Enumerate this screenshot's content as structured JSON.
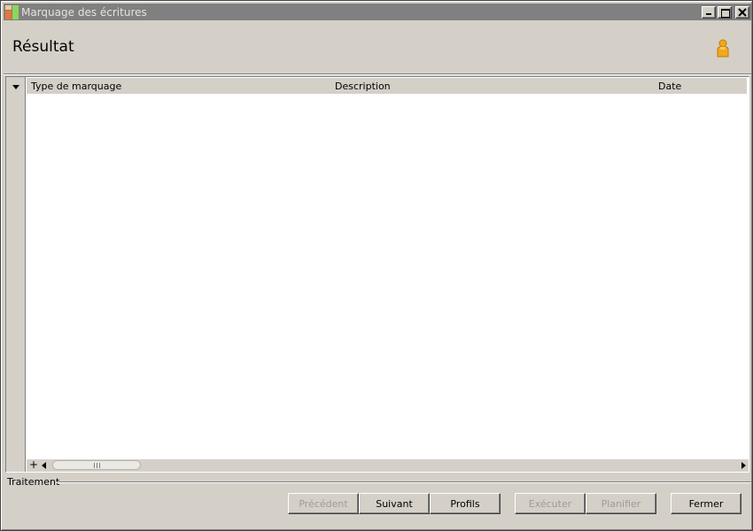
{
  "window": {
    "title": "Marquage des écritures"
  },
  "page": {
    "title": "Résultat",
    "user_icon": "person-icon"
  },
  "grid": {
    "columns": [
      "Type de marquage",
      "Description",
      "Date"
    ],
    "rows": [],
    "scroll_plus": "+"
  },
  "section": {
    "label": "Traitement"
  },
  "buttons": {
    "previous": "Précédent",
    "next": "Suivant",
    "profiles": "Profils",
    "execute": "Exécuter",
    "schedule": "Planifier",
    "close": "Fermer"
  },
  "colors": {
    "titlebar": "#808080",
    "window_bg": "#d4d0c8",
    "disabled_text": "#a09c94",
    "person_icon": "#f0a81c"
  }
}
